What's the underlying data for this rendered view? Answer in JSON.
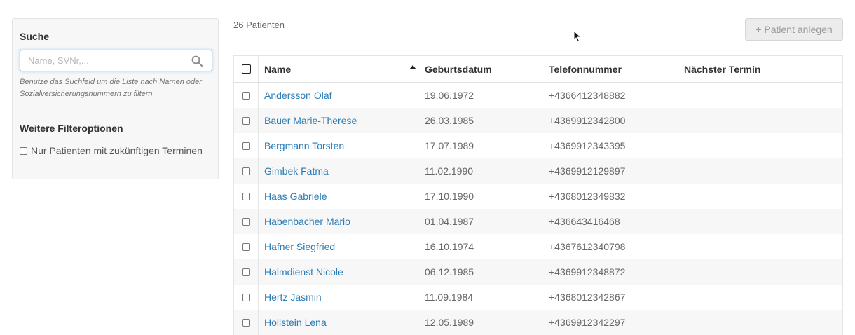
{
  "sidebar": {
    "search_title": "Suche",
    "search_placeholder": "Name, SVNr,...",
    "search_help": "Benutze das Suchfeld um die Liste nach Namen oder Sozialversicherungsnummern zu filtern.",
    "filter_title": "Weitere Filteroptionen",
    "filter_option": "Nur Patienten mit zukünftigen Terminen"
  },
  "header": {
    "count": "26 Patienten",
    "add_button": "+ Patient anlegen"
  },
  "table": {
    "columns": {
      "name": "Name",
      "dob": "Geburtsdatum",
      "tel": "Telefonnummer",
      "next": "Nächster Termin"
    },
    "sort": {
      "column": "name",
      "direction": "ascending"
    },
    "rows": [
      {
        "name": "Andersson Olaf",
        "dob": "19.06.1972",
        "tel": "+4366412348882",
        "next": ""
      },
      {
        "name": "Bauer Marie-Therese",
        "dob": "26.03.1985",
        "tel": "+4369912342800",
        "next": ""
      },
      {
        "name": "Bergmann Torsten",
        "dob": "17.07.1989",
        "tel": "+4369912343395",
        "next": ""
      },
      {
        "name": "Gimbek Fatma",
        "dob": "11.02.1990",
        "tel": "+4369912129897",
        "next": ""
      },
      {
        "name": "Haas Gabriele",
        "dob": "17.10.1990",
        "tel": "+4368012349832",
        "next": ""
      },
      {
        "name": "Habenbacher Mario",
        "dob": "01.04.1987",
        "tel": "+436643416468",
        "next": ""
      },
      {
        "name": "Hafner Siegfried",
        "dob": "16.10.1974",
        "tel": "+4367612340798",
        "next": ""
      },
      {
        "name": "Halmdienst Nicole",
        "dob": "06.12.1985",
        "tel": "+4369912348872",
        "next": ""
      },
      {
        "name": "Hertz Jasmin",
        "dob": "11.09.1984",
        "tel": "+4368012342867",
        "next": ""
      },
      {
        "name": "Hollstein Lena",
        "dob": "12.05.1989",
        "tel": "+4369912342297",
        "next": ""
      }
    ]
  },
  "icons": {
    "search": "search-icon",
    "sort": "sort-ascending-icon",
    "cursor": "mouse-pointer-icon"
  },
  "colors": {
    "link": "#2a7cb5",
    "focus_border": "#66afe9",
    "row_alt": "#f7f7f7"
  }
}
